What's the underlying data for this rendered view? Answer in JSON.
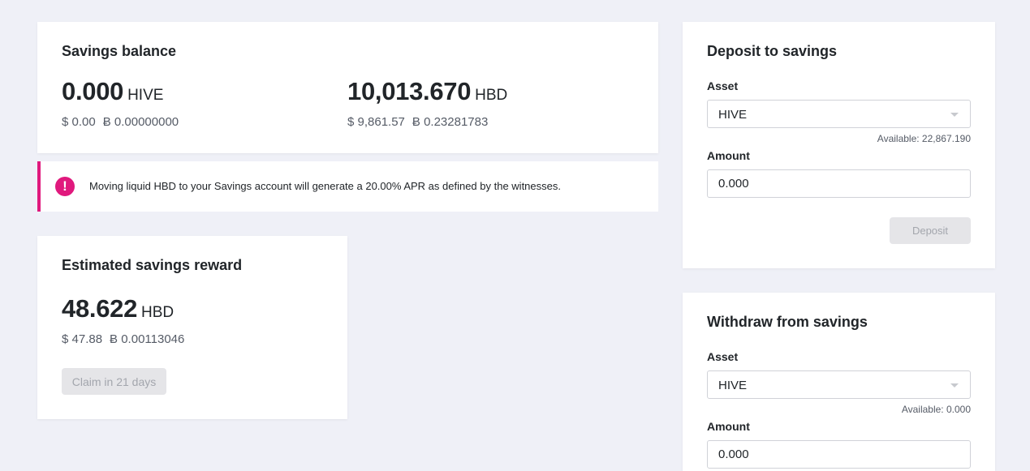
{
  "balance": {
    "title": "Savings balance",
    "hive": {
      "amount": "0.000",
      "unit": "HIVE",
      "usd": "$ 0.00",
      "btc": "Ƀ 0.00000000"
    },
    "hbd": {
      "amount": "10,013.670",
      "unit": "HBD",
      "usd": "$ 9,861.57",
      "btc": "Ƀ 0.23281783"
    }
  },
  "alert": {
    "icon": "!",
    "text": "Moving liquid HBD to your Savings account will generate a 20.00% APR as defined by the witnesses.",
    "accent_color": "#e0197d"
  },
  "reward": {
    "title": "Estimated savings reward",
    "amount": "48.622",
    "unit": "HBD",
    "usd": "$ 47.88",
    "btc": "Ƀ 0.00113046",
    "claim_label": "Claim in 21 days"
  },
  "deposit": {
    "title": "Deposit to savings",
    "asset_label": "Asset",
    "asset_value": "HIVE",
    "available": "Available: 22,867.190",
    "amount_label": "Amount",
    "amount_value": "0.000",
    "button_label": "Deposit"
  },
  "withdraw": {
    "title": "Withdraw from savings",
    "asset_label": "Asset",
    "asset_value": "HIVE",
    "available": "Available: 0.000",
    "amount_label": "Amount",
    "amount_value": "0.000"
  }
}
